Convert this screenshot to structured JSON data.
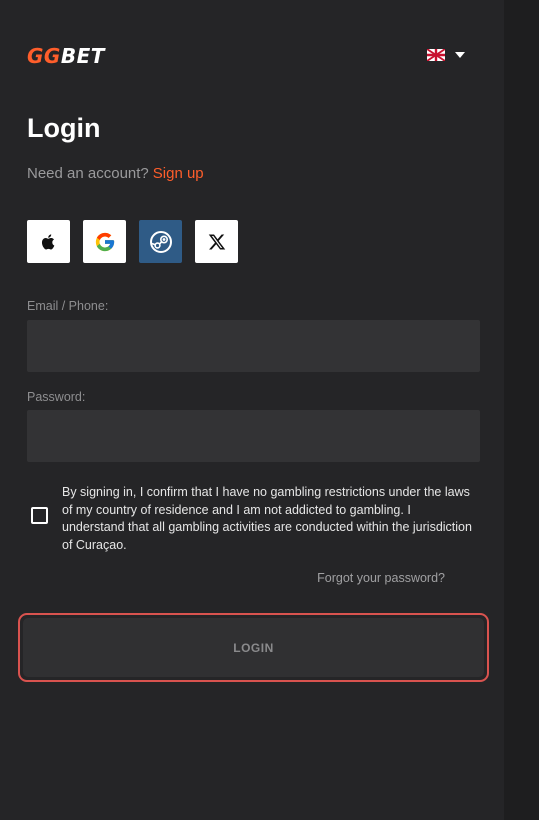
{
  "brand": {
    "logo_gg": "GG",
    "logo_bet": "BET",
    "logo_gg_color": "#ff5e2b"
  },
  "language": {
    "flag_icon": "uk-flag-icon",
    "dropdown_icon": "caret-down-icon"
  },
  "login": {
    "title": "Login",
    "need_account": "Need an account?",
    "signup_link": "Sign up",
    "social": [
      {
        "name": "apple",
        "icon": "apple-icon"
      },
      {
        "name": "google",
        "icon": "google-icon"
      },
      {
        "name": "steam",
        "icon": "steam-icon"
      },
      {
        "name": "x",
        "icon": "x-icon"
      }
    ],
    "email_label": "Email / Phone:",
    "email_value": "",
    "password_label": "Password:",
    "password_value": "",
    "terms_checked": false,
    "terms_text": "By signing in, I confirm that I have no gambling restrictions under the laws of my country of residence and I am not addicted to gambling. I understand that all gambling activities are conducted within the jurisdiction of Curaçao.",
    "forgot_password": "Forgot your password?",
    "login_button": "LOGIN"
  },
  "colors": {
    "accent": "#ff5e2b",
    "background": "#252527",
    "input_bg": "#333335",
    "highlight_ring": "#d9534f",
    "steam_bg": "#2f5b86"
  }
}
